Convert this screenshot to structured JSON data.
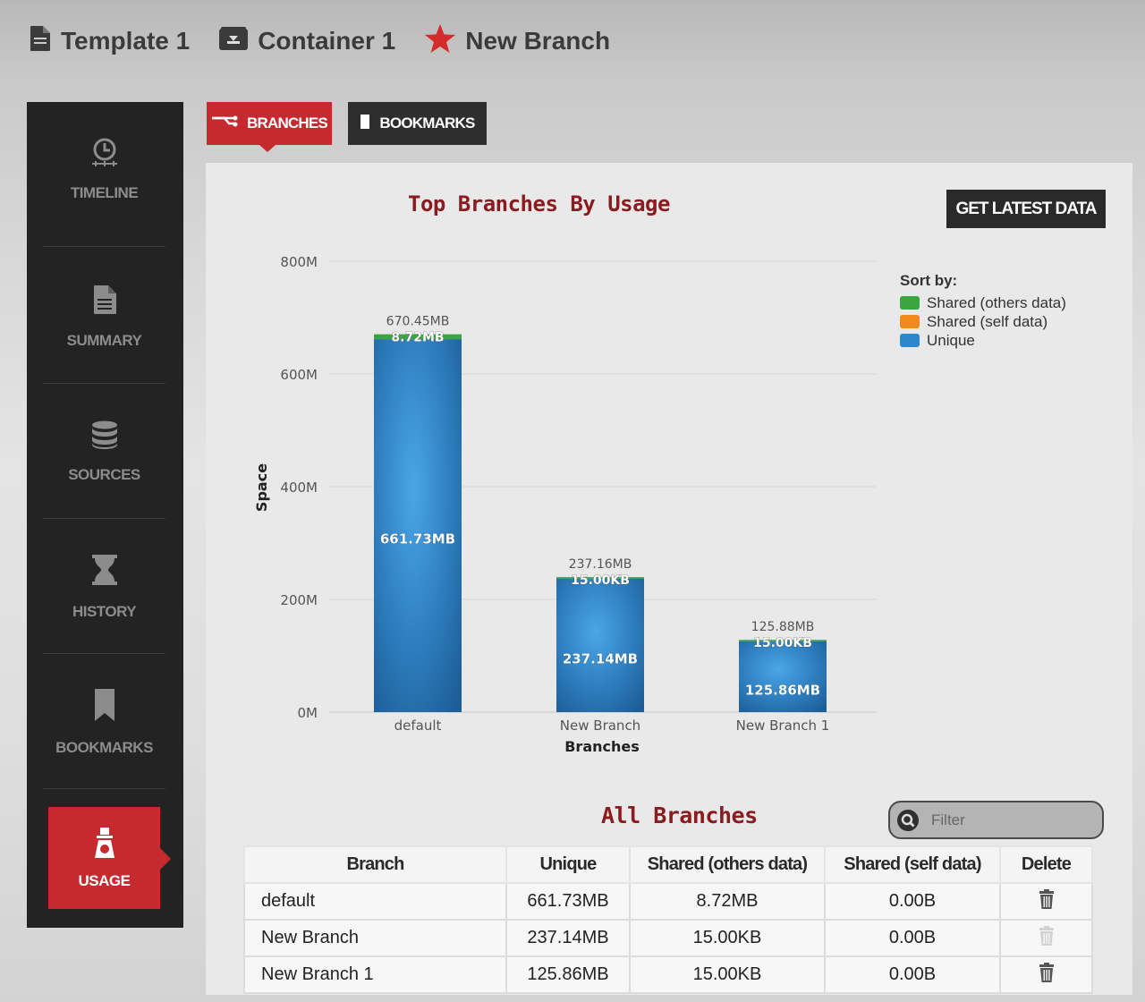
{
  "breadcrumb": [
    {
      "label": "Template 1",
      "icon": "document-icon"
    },
    {
      "label": "Container 1",
      "icon": "container-icon"
    },
    {
      "label": "New Branch",
      "icon": "star-icon"
    }
  ],
  "sidebar": {
    "items": [
      {
        "label": "TIMELINE",
        "icon": "clock-icon"
      },
      {
        "label": "SUMMARY",
        "icon": "document-icon"
      },
      {
        "label": "SOURCES",
        "icon": "database-icon"
      },
      {
        "label": "HISTORY",
        "icon": "hourglass-icon"
      },
      {
        "label": "BOOKMARKS",
        "icon": "bookmark-icon"
      },
      {
        "label": "USAGE",
        "icon": "scale-icon",
        "active": true
      }
    ]
  },
  "tabs": [
    {
      "label": "BRANCHES",
      "icon": "branch-icon",
      "active": true
    },
    {
      "label": "BOOKMARKS",
      "icon": "bookmark-icon",
      "active": false
    }
  ],
  "usage": {
    "get_latest_label": "GET LATEST DATA"
  },
  "colors": {
    "accent": "#c62a2f",
    "shared_others": "#3aa63f",
    "shared_self": "#f28a1b",
    "unique": "#2f86c9"
  },
  "chart_data": {
    "type": "bar",
    "stacked": true,
    "title": "Top Branches By Usage",
    "xlabel": "Branches",
    "ylabel": "Space",
    "categories": [
      "default",
      "New Branch",
      "New Branch 1"
    ],
    "ylim": [
      0,
      800
    ],
    "yticks": [
      "0M",
      "200M",
      "400M",
      "600M",
      "800M"
    ],
    "grid": true,
    "legend_title": "Sort by:",
    "legend_position": "top-right",
    "series": [
      {
        "name": "Unique",
        "values": [
          661.73,
          237.14,
          125.86
        ],
        "labels": [
          "661.73MB",
          "237.14MB",
          "125.86MB"
        ]
      },
      {
        "name": "Shared (self data)",
        "values": [
          0,
          0,
          0
        ],
        "labels": [
          "",
          "",
          ""
        ]
      },
      {
        "name": "Shared (others data)",
        "values": [
          8.72,
          0.015,
          0.015
        ],
        "labels": [
          "8.72MB",
          "15.00KB",
          "15.00KB"
        ]
      }
    ],
    "totals": [
      "670.45MB",
      "237.16MB",
      "125.88MB"
    ],
    "legend": [
      "Shared (others data)",
      "Shared (self data)",
      "Unique"
    ]
  },
  "all_branches": {
    "title": "All Branches",
    "filter_placeholder": "Filter",
    "columns": [
      "Branch",
      "Unique",
      "Shared (others data)",
      "Shared (self data)",
      "Delete"
    ],
    "rows": [
      {
        "branch": "default",
        "unique": "661.73MB",
        "shared_others": "8.72MB",
        "shared_self": "0.00B",
        "deletable": true
      },
      {
        "branch": "New Branch",
        "unique": "237.14MB",
        "shared_others": "15.00KB",
        "shared_self": "0.00B",
        "deletable": false
      },
      {
        "branch": "New Branch 1",
        "unique": "125.86MB",
        "shared_others": "15.00KB",
        "shared_self": "0.00B",
        "deletable": true
      }
    ]
  }
}
